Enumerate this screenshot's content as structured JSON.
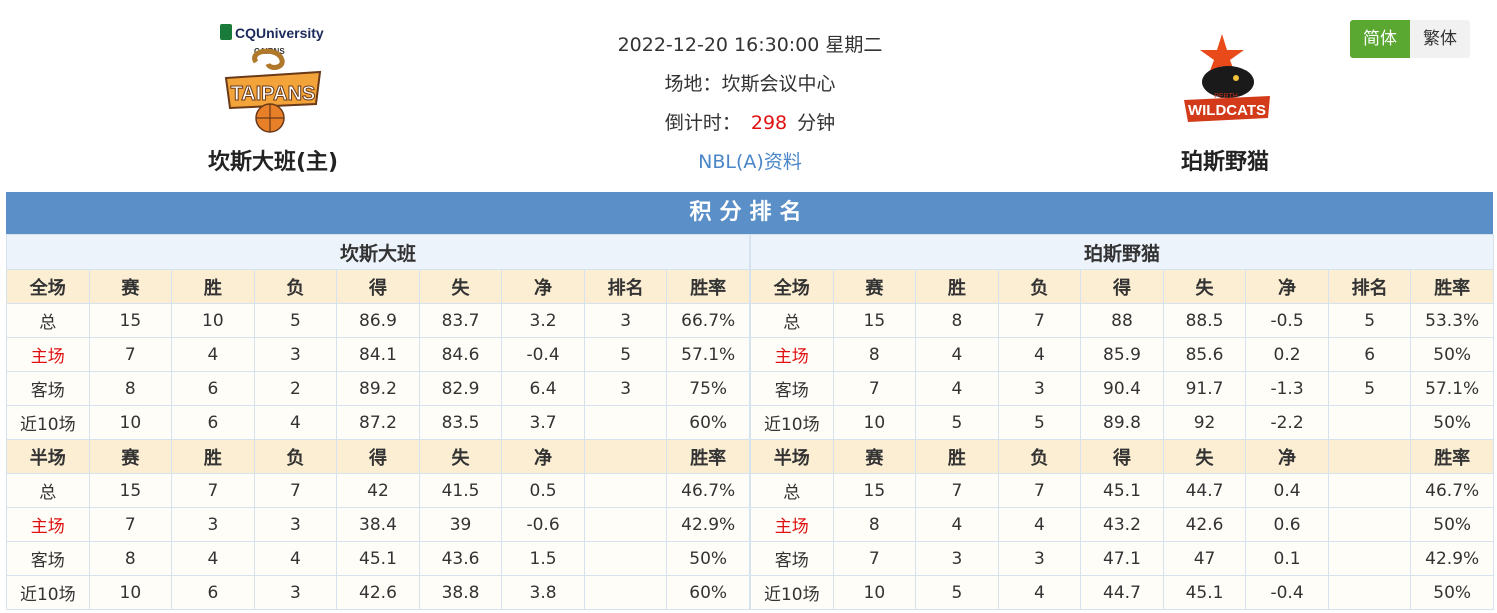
{
  "lang": {
    "simplified": "简体",
    "traditional": "繁体"
  },
  "match": {
    "datetime": "2022-12-20 16:30:00 星期二",
    "venue_label": "场地：",
    "venue": "坎斯会议中心",
    "countdown_label": "倒计时：",
    "countdown_value": "298",
    "countdown_unit": "分钟",
    "league_link": "NBL(A)资料"
  },
  "home": {
    "name": "坎斯大班(主)",
    "logo_sponsor": "CQUniversity",
    "logo_city": "CAIRNS",
    "logo_word": "TAIPANS"
  },
  "away": {
    "name": "珀斯野猫",
    "logo_city": "PERTH",
    "logo_word": "WILDCATS"
  },
  "section_title": "积分排名",
  "colors": {
    "accent": "#5b8fc7",
    "active": "#5aa832",
    "red": "#e01010",
    "header_bg": "#fbeed3"
  },
  "tables": [
    {
      "team": "坎斯大班",
      "full_headers": [
        "全场",
        "赛",
        "胜",
        "负",
        "得",
        "失",
        "净",
        "排名",
        "胜率"
      ],
      "full_rows": [
        [
          "总",
          "15",
          "10",
          "5",
          "86.9",
          "83.7",
          "3.2",
          "3",
          "66.7%"
        ],
        [
          "主场",
          "7",
          "4",
          "3",
          "84.1",
          "84.6",
          "-0.4",
          "5",
          "57.1%"
        ],
        [
          "客场",
          "8",
          "6",
          "2",
          "89.2",
          "82.9",
          "6.4",
          "3",
          "75%"
        ],
        [
          "近10场",
          "10",
          "6",
          "4",
          "87.2",
          "83.5",
          "3.7",
          "",
          "60%"
        ]
      ],
      "half_headers": [
        "半场",
        "赛",
        "胜",
        "负",
        "得",
        "失",
        "净",
        "",
        "胜率"
      ],
      "half_rows": [
        [
          "总",
          "15",
          "7",
          "7",
          "42",
          "41.5",
          "0.5",
          "",
          "46.7%"
        ],
        [
          "主场",
          "7",
          "3",
          "3",
          "38.4",
          "39",
          "-0.6",
          "",
          "42.9%"
        ],
        [
          "客场",
          "8",
          "4",
          "4",
          "45.1",
          "43.6",
          "1.5",
          "",
          "50%"
        ],
        [
          "近10场",
          "10",
          "6",
          "3",
          "42.6",
          "38.8",
          "3.8",
          "",
          "60%"
        ]
      ]
    },
    {
      "team": "珀斯野猫",
      "full_headers": [
        "全场",
        "赛",
        "胜",
        "负",
        "得",
        "失",
        "净",
        "排名",
        "胜率"
      ],
      "full_rows": [
        [
          "总",
          "15",
          "8",
          "7",
          "88",
          "88.5",
          "-0.5",
          "5",
          "53.3%"
        ],
        [
          "主场",
          "8",
          "4",
          "4",
          "85.9",
          "85.6",
          "0.2",
          "6",
          "50%"
        ],
        [
          "客场",
          "7",
          "4",
          "3",
          "90.4",
          "91.7",
          "-1.3",
          "5",
          "57.1%"
        ],
        [
          "近10场",
          "10",
          "5",
          "5",
          "89.8",
          "92",
          "-2.2",
          "",
          "50%"
        ]
      ],
      "half_headers": [
        "半场",
        "赛",
        "胜",
        "负",
        "得",
        "失",
        "净",
        "",
        "胜率"
      ],
      "half_rows": [
        [
          "总",
          "15",
          "7",
          "7",
          "45.1",
          "44.7",
          "0.4",
          "",
          "46.7%"
        ],
        [
          "主场",
          "8",
          "4",
          "4",
          "43.2",
          "42.6",
          "0.6",
          "",
          "50%"
        ],
        [
          "客场",
          "7",
          "3",
          "3",
          "47.1",
          "47",
          "0.1",
          "",
          "42.9%"
        ],
        [
          "近10场",
          "10",
          "5",
          "4",
          "44.7",
          "45.1",
          "-0.4",
          "",
          "50%"
        ]
      ]
    }
  ]
}
